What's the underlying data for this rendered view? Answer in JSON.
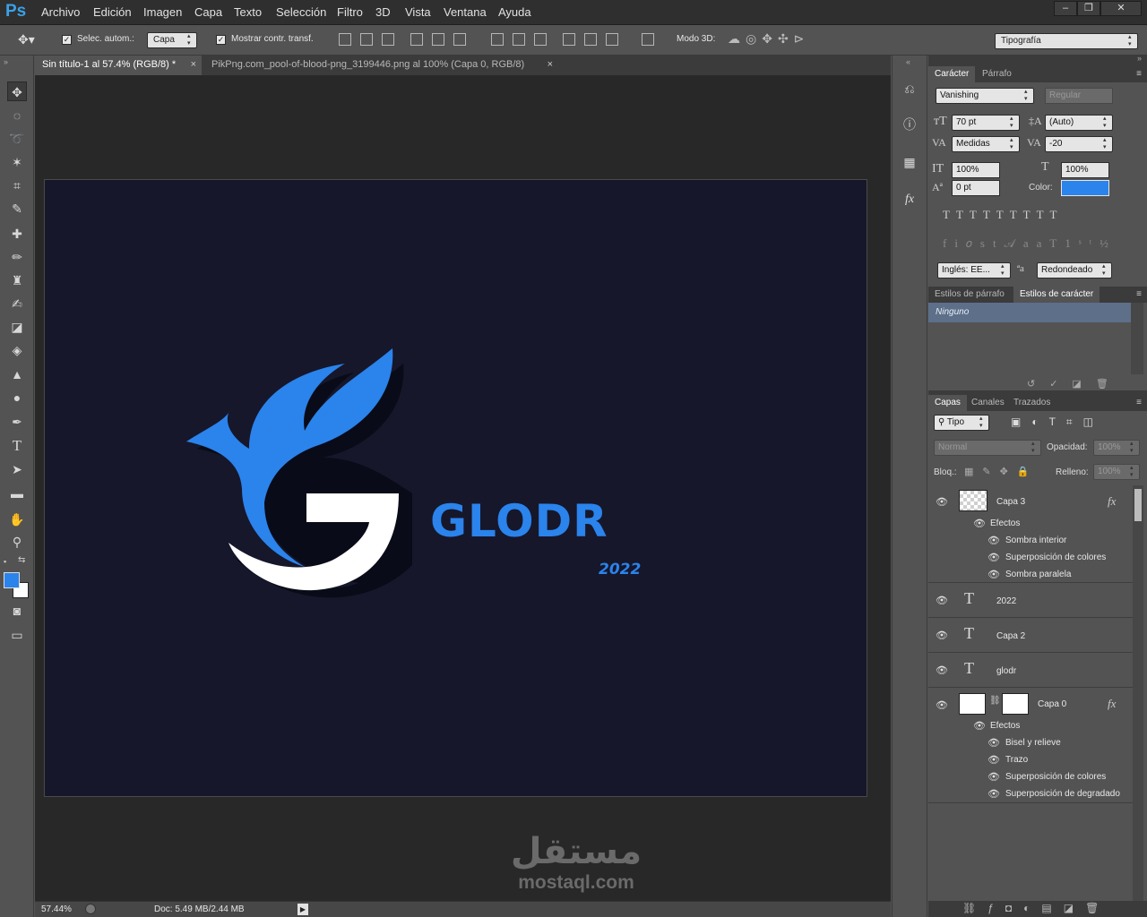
{
  "app": {
    "logo": "Ps"
  },
  "menu": [
    "Archivo",
    "Edición",
    "Imagen",
    "Capa",
    "Texto",
    "Selección",
    "Filtro",
    "3D",
    "Vista",
    "Ventana",
    "Ayuda"
  ],
  "window_controls": {
    "minimize": "–",
    "restore": "❐",
    "close": "✕"
  },
  "options": {
    "auto_select_label": "Selec. autom.:",
    "auto_select_value": "Capa",
    "show_transform_label": "Mostrar contr. transf.",
    "mode3d_label": "Modo 3D:",
    "workspace": "Tipografía"
  },
  "tabs": [
    {
      "label": "Sin título-1 al 57.4% (RGB/8) *"
    },
    {
      "label": "PikPng.com_pool-of-blood-png_3199446.png al 100% (Capa 0, RGB/8)"
    }
  ],
  "canvas": {
    "logo_text": "GLODR",
    "year_text": "2022",
    "bg_color": "#16172b",
    "accent": "#2b83ec"
  },
  "status": {
    "zoom": "57.44%",
    "doc": "Doc: 5.49 MB/2.44 MB"
  },
  "watermark": {
    "arabic": "مستقل",
    "latin": "mostaql.com"
  },
  "character": {
    "tabs": [
      "Carácter",
      "Párrafo"
    ],
    "font_family": "Vanishing",
    "font_style": "Regular",
    "size": "70 pt",
    "leading": "(Auto)",
    "kerning": "Medidas",
    "tracking": "-20",
    "vscale": "100%",
    "hscale": "100%",
    "baseline": "0 pt",
    "color_label": "Color:",
    "color": "#2b83ec",
    "language": "Inglés: EE...",
    "antialias": "Redondeado"
  },
  "styles": {
    "tabs": [
      "Estilos de párrafo",
      "Estilos de carácter"
    ],
    "selected": "Ninguno"
  },
  "layers": {
    "tabs": [
      "Capas",
      "Canales",
      "Trazados"
    ],
    "filter": "Tipo",
    "blend": "Normal",
    "opacity_label": "Opacidad:",
    "opacity": "100%",
    "lock_label": "Bloq.:",
    "fill_label": "Relleno:",
    "fill": "100%",
    "effects_label": "Efectos",
    "items": [
      {
        "name": "Capa 3",
        "effects": [
          "Sombra interior",
          "Superposición de colores",
          "Sombra paralela"
        ]
      },
      {
        "name": "2022"
      },
      {
        "name": "Capa 2"
      },
      {
        "name": "glodr"
      },
      {
        "name": "Capa 0",
        "effects": [
          "Bisel y relieve",
          "Trazo",
          "Superposición de colores",
          "Superposición de degradado"
        ]
      }
    ]
  }
}
